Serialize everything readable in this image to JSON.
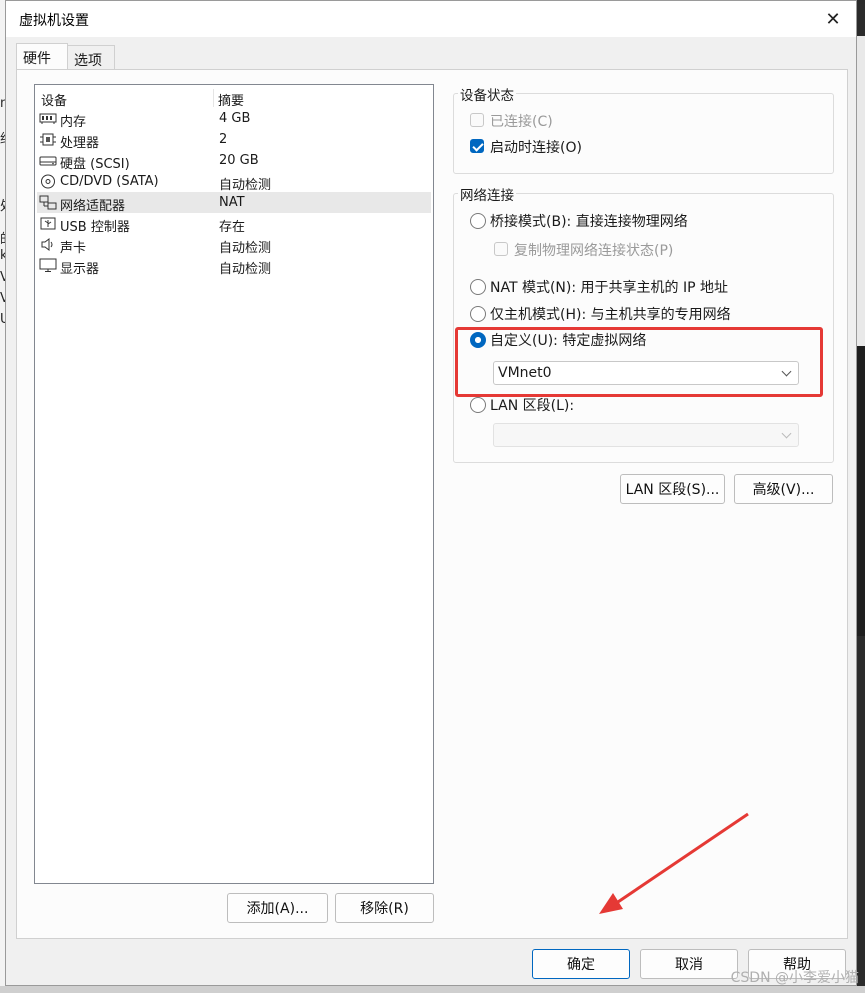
{
  "window": {
    "title": "虚拟机设置",
    "close_glyph": "✕"
  },
  "tabs": [
    {
      "label": "硬件"
    },
    {
      "label": "选项"
    }
  ],
  "device_list": {
    "col_device": "设备",
    "col_summary": "摘要",
    "rows": [
      {
        "name": "内存",
        "summary": "4 GB",
        "icon": "memory-icon"
      },
      {
        "name": "处理器",
        "summary": "2",
        "icon": "processor-icon"
      },
      {
        "name": "硬盘 (SCSI)",
        "summary": "20 GB",
        "icon": "hard-disk-icon"
      },
      {
        "name": "CD/DVD (SATA)",
        "summary": "自动检测",
        "icon": "cd-dvd-icon"
      },
      {
        "name": "网络适配器",
        "summary": "NAT",
        "icon": "network-adapter-icon",
        "selected": true
      },
      {
        "name": "USB 控制器",
        "summary": "存在",
        "icon": "usb-icon"
      },
      {
        "name": "声卡",
        "summary": "自动检测",
        "icon": "sound-card-icon"
      },
      {
        "name": "显示器",
        "summary": "自动检测",
        "icon": "display-icon"
      }
    ]
  },
  "left_buttons": {
    "add": "添加(A)...",
    "remove": "移除(R)"
  },
  "device_status": {
    "title": "设备状态",
    "connected": {
      "label": "已连接(C)",
      "checked": false,
      "disabled": true
    },
    "connect_on_start": {
      "label": "启动时连接(O)",
      "checked": true
    }
  },
  "network": {
    "title": "网络连接",
    "bridged": "桥接模式(B): 直接连接物理网络",
    "replicate": "复制物理网络连接状态(P)",
    "nat": "NAT 模式(N): 用于共享主机的 IP 地址",
    "host_only": "仅主机模式(H): 与主机共享的专用网络",
    "custom": "自定义(U): 特定虚拟网络",
    "custom_value": "VMnet0",
    "lan_segment": "LAN 区段(L):",
    "selected": "custom"
  },
  "right_buttons": {
    "lan_segments": "LAN 区段(S)...",
    "advanced": "高级(V)..."
  },
  "footer": {
    "ok": "确定",
    "cancel": "取消",
    "help": "帮助"
  },
  "background": {
    "fragments": [
      "n",
      "约",
      "处",
      "的",
      "k",
      "V",
      "V",
      "U"
    ]
  },
  "watermark": "CSDN @小李爱小猫",
  "colors": {
    "accent": "#0067c0",
    "highlight": "#e53935"
  }
}
